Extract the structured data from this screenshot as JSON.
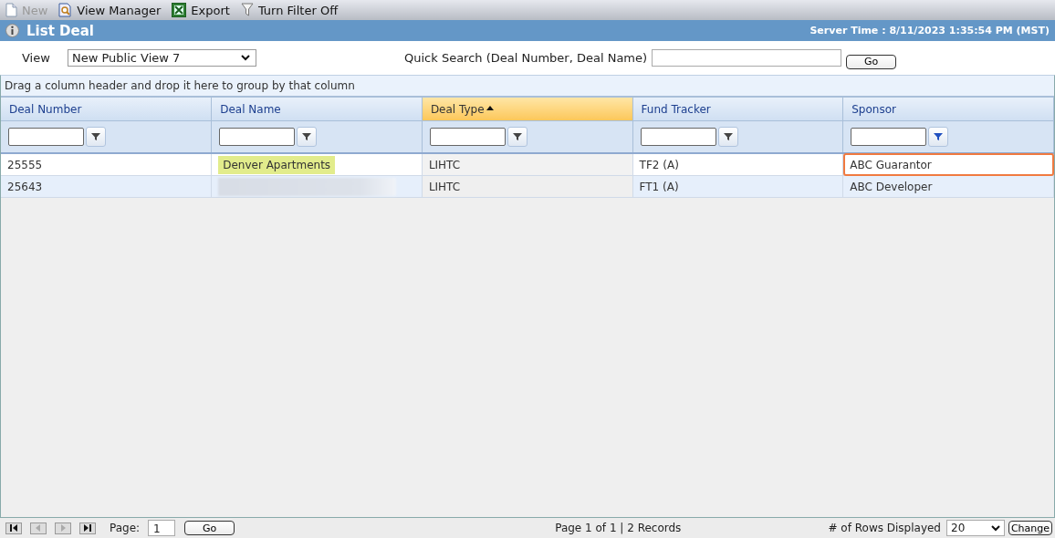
{
  "toolbar": [
    {
      "kind": "new",
      "label": "New",
      "disabled": true
    },
    {
      "kind": "view-manager",
      "label": "View Manager",
      "disabled": false
    },
    {
      "kind": "export",
      "label": "Export",
      "disabled": false
    },
    {
      "kind": "filter",
      "label": "Turn Filter Off",
      "disabled": false
    }
  ],
  "header": {
    "title": "List Deal",
    "server_time": "Server Time : 8/11/2023 1:35:54 PM (MST)"
  },
  "view": {
    "label": "View",
    "value": "New Public View 7"
  },
  "quick_search": {
    "label": "Quick Search (Deal Number, Deal Name)",
    "button": "Go"
  },
  "group_panel": "Drag a column header and drop it here to group by that column",
  "columns": [
    {
      "label": "Deal Number",
      "sorted": false,
      "filter_active": false
    },
    {
      "label": "Deal Name",
      "sorted": false,
      "filter_active": false
    },
    {
      "label": "Deal Type",
      "sorted": true,
      "filter_active": false
    },
    {
      "label": "Fund Tracker",
      "sorted": false,
      "filter_active": false
    },
    {
      "label": "Sponsor",
      "sorted": false,
      "filter_active": true
    }
  ],
  "rows": [
    {
      "cells": [
        {
          "kind": "text",
          "text": "25555",
          "highlighted": false,
          "focused": false
        },
        {
          "kind": "text",
          "text": "Denver Apartments",
          "highlighted": true,
          "focused": false
        },
        {
          "kind": "text",
          "text": "LIHTC",
          "highlighted": false,
          "focused": false
        },
        {
          "kind": "text",
          "text": "TF2 (A)",
          "highlighted": false,
          "focused": false
        },
        {
          "kind": "text",
          "text": "ABC Guarantor",
          "highlighted": false,
          "focused": true
        }
      ]
    },
    {
      "cells": [
        {
          "kind": "text",
          "text": "25643",
          "highlighted": false,
          "focused": false
        },
        {
          "kind": "redacted"
        },
        {
          "kind": "text",
          "text": "LIHTC",
          "highlighted": false,
          "focused": false
        },
        {
          "kind": "text",
          "text": "FT1 (A)",
          "highlighted": false,
          "focused": false
        },
        {
          "kind": "text",
          "text": "ABC Developer",
          "highlighted": false,
          "focused": false
        }
      ]
    }
  ],
  "pager": {
    "page_label": "Page:",
    "page_value": "1",
    "go": "Go",
    "summary": "Page 1 of 1 | 2 Records",
    "rows_label": "# of Rows Displayed",
    "rows_value": "20",
    "change": "Change"
  }
}
